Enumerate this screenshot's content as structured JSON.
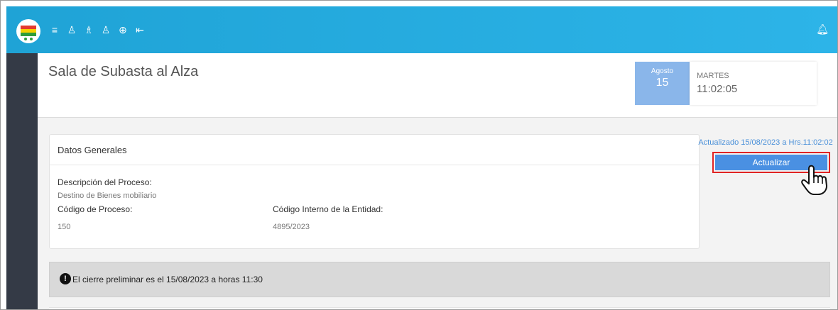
{
  "topbar": {
    "nav_icons": [
      "menu-icon",
      "user-icon",
      "user-dollar-icon",
      "user-outline-icon",
      "lock-icon",
      "logout-icon"
    ],
    "nav_glyphs": [
      "≡",
      "♙",
      "♗",
      "♙",
      "⊕",
      "⇤"
    ],
    "bell_glyph": "🔔︎"
  },
  "page": {
    "title": "Sala de Subasta al Alza"
  },
  "date": {
    "month": "Agosto",
    "day": "15",
    "weekday": "MARTES",
    "time": "11:02:05"
  },
  "card": {
    "title": "Datos Generales",
    "desc_label": "Descripción del Proceso:",
    "desc_value": "Destino de Bienes mobiliario",
    "code_label": "Código de Proceso:",
    "code_value": "150",
    "internal_label": "Código Interno de la Entidad:",
    "internal_value": "4895/2023"
  },
  "update": {
    "status": "Actualizado 15/08/2023 a Hrs.11:02:02",
    "button_label": "Actualizar"
  },
  "alert": {
    "icon": "!",
    "text": "El cierre preliminar es el 15/08/2023 a horas 11:30"
  },
  "colors": {
    "topbar": "#2aaee3",
    "sidebar": "#343a46",
    "button": "#4a90e2",
    "highlight": "#e02424"
  }
}
